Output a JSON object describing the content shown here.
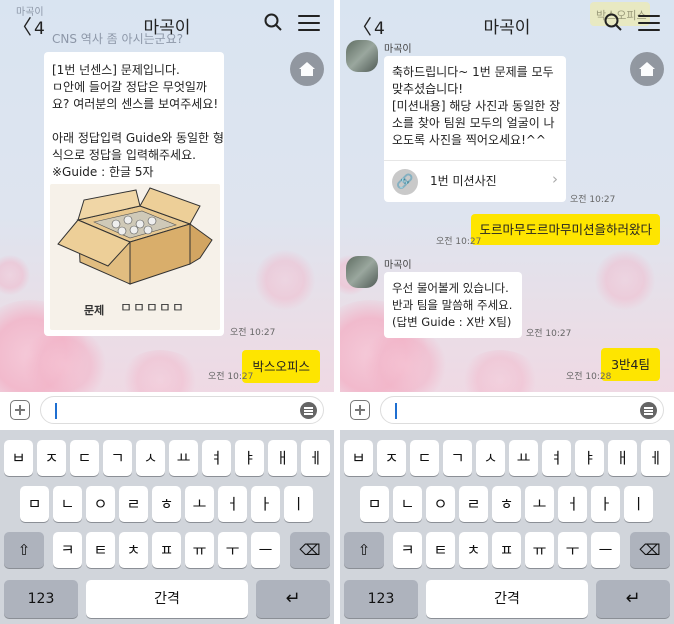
{
  "screens": [
    {
      "topbar": {
        "back_count": "4",
        "title": "마곡이"
      },
      "ghost_top": {
        "sender": "마곡이",
        "text": "CNS 역사 좀 아시는군요?"
      },
      "message": {
        "lines": [
          "[1번 넌센스] 문제입니다.",
          "ㅁ안에 들어갈 정답은 무엇일까",
          "요? 여러분의 센스를 보여주세요!",
          "",
          "아래 정답입력 Guide와 동일한 형",
          "식으로 정답을 입력해주세요.",
          "※Guide : 한글 5자"
        ],
        "image_caption": "문제",
        "image_boxes": "ㅁㅁㅁㅁㅁ",
        "time": "오전 10:27"
      },
      "reply": {
        "text": "박스오피스",
        "time": "오전 10:27"
      }
    },
    {
      "topbar": {
        "back_count": "4",
        "title": "마곡이"
      },
      "ghost_top": {
        "text": "박스오피스"
      },
      "msg1": {
        "sender": "마곡이",
        "lines": [
          "축하드립니다~ 1번 문제를 모두",
          "맞추셨습니다!",
          "[미션내용] 해당 사진과 동일한 장",
          "소를 찾아 팀원 모두의 얼굴이 나",
          "오도록 사진을 찍어오세요!^^"
        ],
        "link_label": "1번 미션사진",
        "time": "오전 10:27"
      },
      "reply1": {
        "text": "도르마무도르마무미션을하러왔다",
        "time": "오전 10:27"
      },
      "msg2": {
        "sender": "마곡이",
        "lines": [
          "우선 물어볼게 있습니다.",
          "반과 팀을 말씀해 주세요.",
          "(답변 Guide : X반 X팀)"
        ],
        "time": "오전 10:27"
      },
      "reply2": {
        "text": "3반4팀",
        "time": "오전 10:28"
      }
    }
  ],
  "keyboard": {
    "row1": [
      "ㅂ",
      "ㅈ",
      "ㄷ",
      "ㄱ",
      "ㅅ",
      "ㅛ",
      "ㅕ",
      "ㅑ",
      "ㅐ",
      "ㅔ"
    ],
    "row2": [
      "ㅁ",
      "ㄴ",
      "ㅇ",
      "ㄹ",
      "ㅎ",
      "ㅗ",
      "ㅓ",
      "ㅏ",
      "ㅣ"
    ],
    "row3": [
      "ㅋ",
      "ㅌ",
      "ㅊ",
      "ㅍ",
      "ㅠ",
      "ㅜ",
      "ㅡ"
    ],
    "numbers": "123",
    "space": "간격"
  },
  "colors": {
    "accent_yellow": "#fee500",
    "caret_blue": "#1f6fd1"
  }
}
